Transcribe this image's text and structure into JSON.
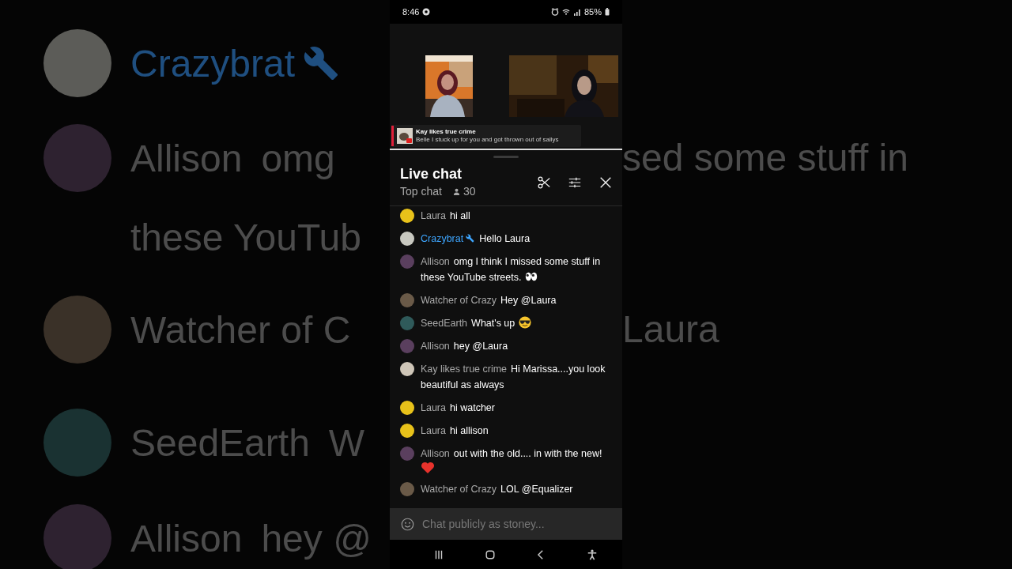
{
  "backdrop": {
    "left": [
      {
        "author": "Crazybrat",
        "moderator": true,
        "color": "#5c5c58"
      },
      {
        "author": "Allison",
        "text": "omg",
        "moderator": false,
        "color": "#2e2230"
      },
      {
        "text": "these YouTub",
        "moderator": false
      },
      {
        "author": "Watcher of C",
        "moderator": false,
        "color": "#3a3128"
      },
      {
        "author": "SeedEarth",
        "text": "W",
        "moderator": false,
        "color": "#1a3232"
      },
      {
        "author": "Allison",
        "text": "hey @",
        "moderator": false,
        "color": "#2e2230"
      }
    ],
    "right": [
      {
        "text": "sed some stuff in"
      },
      {
        "text": "Laura"
      }
    ]
  },
  "status_bar": {
    "time": "8:46",
    "battery": "85%"
  },
  "stream": {
    "ticker": {
      "author": "Kay likes true crime",
      "text": "Belle I stuck up for you and got thrown out of sallys"
    }
  },
  "chat": {
    "title": "Live chat",
    "mode": "Top chat",
    "viewers": "30",
    "messages": [
      {
        "author": "Laura",
        "text": "hi all",
        "moderator": false,
        "color": "#e8c21a",
        "kind": "plain"
      },
      {
        "author": "Crazybrat",
        "text": "Hello Laura",
        "moderator": true,
        "color": "#c8c8c0",
        "kind": "plain"
      },
      {
        "author": "Allison",
        "text": "omg I think I missed some stuff in these YouTube streets.",
        "moderator": false,
        "color": "#5a3f5e",
        "kind": "eyes"
      },
      {
        "author": "Watcher of Crazy",
        "text": "Hey @Laura",
        "moderator": false,
        "color": "#6a5a48",
        "kind": "plain"
      },
      {
        "author": "SeedEarth",
        "text": "What's up",
        "moderator": false,
        "color": "#2f5a5a",
        "kind": "sunglasses"
      },
      {
        "author": "Allison",
        "text": "hey @Laura",
        "moderator": false,
        "color": "#5a3f5e",
        "kind": "plain"
      },
      {
        "author": "Kay likes true crime",
        "text": "Hi Marissa....you look beautiful as always",
        "moderator": false,
        "color": "#cfc6b8",
        "kind": "plain"
      },
      {
        "author": "Laura",
        "text": "hi watcher",
        "moderator": false,
        "color": "#e8c21a",
        "kind": "plain"
      },
      {
        "author": "Laura",
        "text": "hi allison",
        "moderator": false,
        "color": "#e8c21a",
        "kind": "plain"
      },
      {
        "author": "Allison",
        "text": "out with the old.... in with the new!",
        "moderator": false,
        "color": "#5a3f5e",
        "kind": "heart"
      },
      {
        "author": "Watcher of Crazy",
        "text": "LOL @Equalizer",
        "moderator": false,
        "color": "#6a5a48",
        "kind": "plain"
      }
    ],
    "input": {
      "placeholder": "Chat publicly as stoney..."
    }
  }
}
